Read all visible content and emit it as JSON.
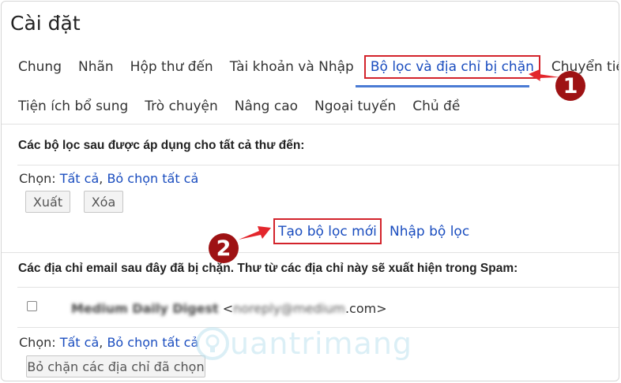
{
  "page": {
    "title": "Cài đặt"
  },
  "tabs_row1": [
    {
      "label": "Chung"
    },
    {
      "label": "Nhãn"
    },
    {
      "label": "Hộp thư đến"
    },
    {
      "label": "Tài khoản và Nhập"
    },
    {
      "label": "Bộ lọc và địa chỉ bị chặn",
      "active": true
    },
    {
      "label": "Chuyển tiếp"
    }
  ],
  "tabs_row2": [
    {
      "label": "Tiện ích bổ sung"
    },
    {
      "label": "Trò chuyện"
    },
    {
      "label": "Nâng cao"
    },
    {
      "label": "Ngoại tuyến"
    },
    {
      "label": "Chủ đề"
    }
  ],
  "filters_section": {
    "heading": "Các bộ lọc sau được áp dụng cho tất cả thư đến:",
    "select_label": "Chọn: ",
    "select_all": "Tất cả",
    "separator": ", ",
    "deselect_all": "Bỏ chọn tất cả",
    "export_button": "Xuất",
    "delete_button": "Xóa",
    "create_filter": "Tạo bộ lọc mới",
    "import_filter": "Nhập bộ lọc"
  },
  "blocked_section": {
    "heading": "Các địa chỉ email sau đây đã bị chặn. Thư từ các địa chỉ này sẽ xuất hiện trong Spam:",
    "items": [
      {
        "name": "Medium Daily Digest",
        "email_prefix": "<",
        "email_local": "noreply@medium",
        "email_suffix": ".com>"
      }
    ],
    "select_label": "Chọn: ",
    "select_all": "Tất cả",
    "separator": ", ",
    "deselect_all": "Bỏ chọn tất cả",
    "unblock_button": "Bỏ chặn các địa chỉ đã chọn"
  },
  "annotations": {
    "step1": "1",
    "step2": "2"
  },
  "watermark": {
    "text": "uantrimang"
  },
  "colors": {
    "link": "#1a4dbf",
    "highlight_border": "#d3232b",
    "badge": "#9e1214",
    "arrow": "#e3262c",
    "tab_underline": "#4a7bd4"
  }
}
